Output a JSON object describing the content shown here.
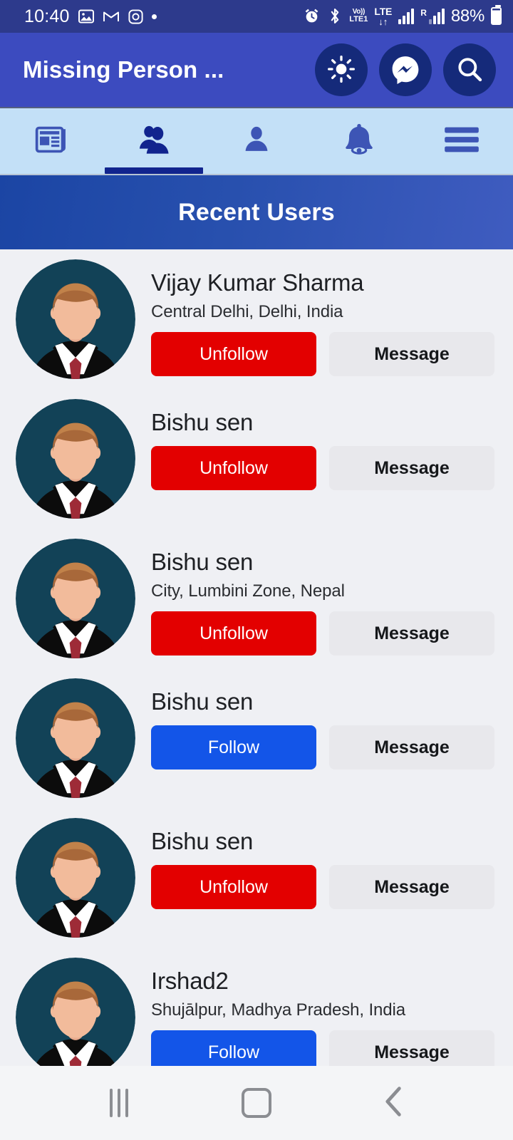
{
  "status_bar": {
    "time": "10:40",
    "left_icons": [
      "photos-icon",
      "gmail-icon",
      "instagram-icon",
      "dot-indicator-icon"
    ],
    "volte_top": "Vo))",
    "volte_bottom": "LTE1",
    "network_type": "LTE",
    "data_arrows": "↓↑",
    "roaming_label": "R",
    "battery_percent": "88%",
    "right_icons": [
      "alarm-icon",
      "bluetooth-icon",
      "volte-icon",
      "lte-data-icon",
      "signal-icon",
      "roaming-signal-icon",
      "battery-icon"
    ]
  },
  "app_bar": {
    "title": "Missing Person ...",
    "actions": [
      {
        "name": "brightness-icon",
        "label": "Brightness"
      },
      {
        "name": "messenger-icon",
        "label": "Messenger"
      },
      {
        "name": "search-icon",
        "label": "Search"
      }
    ]
  },
  "tab_bar": {
    "active_index": 1,
    "tabs": [
      {
        "label": "Feed",
        "icon": "newspaper-icon",
        "active": false
      },
      {
        "label": "Users",
        "icon": "people-icon",
        "active": true
      },
      {
        "label": "Profile",
        "icon": "person-icon",
        "active": false
      },
      {
        "label": "Notifications",
        "icon": "bell-icon",
        "active": false
      },
      {
        "label": "Menu",
        "icon": "hamburger-menu-icon",
        "active": false
      }
    ]
  },
  "section": {
    "title": "Recent Users"
  },
  "users": [
    {
      "name": "Vijay Kumar Sharma",
      "location": "Central Delhi, Delhi, India",
      "follow_label": "Unfollow",
      "follow_state": "following",
      "message_label": "Message"
    },
    {
      "name": "Bishu sen",
      "location": "",
      "follow_label": "Unfollow",
      "follow_state": "following",
      "message_label": "Message"
    },
    {
      "name": "Bishu sen",
      "location": "City, Lumbini Zone, Nepal",
      "follow_label": "Unfollow",
      "follow_state": "following",
      "message_label": "Message"
    },
    {
      "name": "Bishu sen",
      "location": "",
      "follow_label": "Follow",
      "follow_state": "not-following",
      "message_label": "Message"
    },
    {
      "name": "Bishu sen",
      "location": "",
      "follow_label": "Unfollow",
      "follow_state": "following",
      "message_label": "Message"
    },
    {
      "name": "Irshad2",
      "location": "Shujālpur, Madhya Pradesh, India",
      "follow_label": "Follow",
      "follow_state": "not-following",
      "message_label": "Message"
    }
  ],
  "nav_bar": {
    "buttons": [
      {
        "name": "recents-button",
        "label": "Recents"
      },
      {
        "name": "home-button",
        "label": "Home"
      },
      {
        "name": "back-button",
        "label": "Back"
      }
    ]
  },
  "colors": {
    "status_bar_bg": "#2d3a8c",
    "app_bar_bg": "#3c4bbf",
    "app_bar_circle": "#152a7a",
    "tab_bar_bg": "#c3e0f7",
    "tab_active": "#11248e",
    "tab_inactive": "#3d55b5",
    "section_header_bg": "#1b45a4",
    "list_bg": "#eff0f4",
    "unfollow_red": "#e30000",
    "follow_blue": "#1355e8",
    "message_grey": "#e8e8ec",
    "avatar_bg": "#124257"
  }
}
